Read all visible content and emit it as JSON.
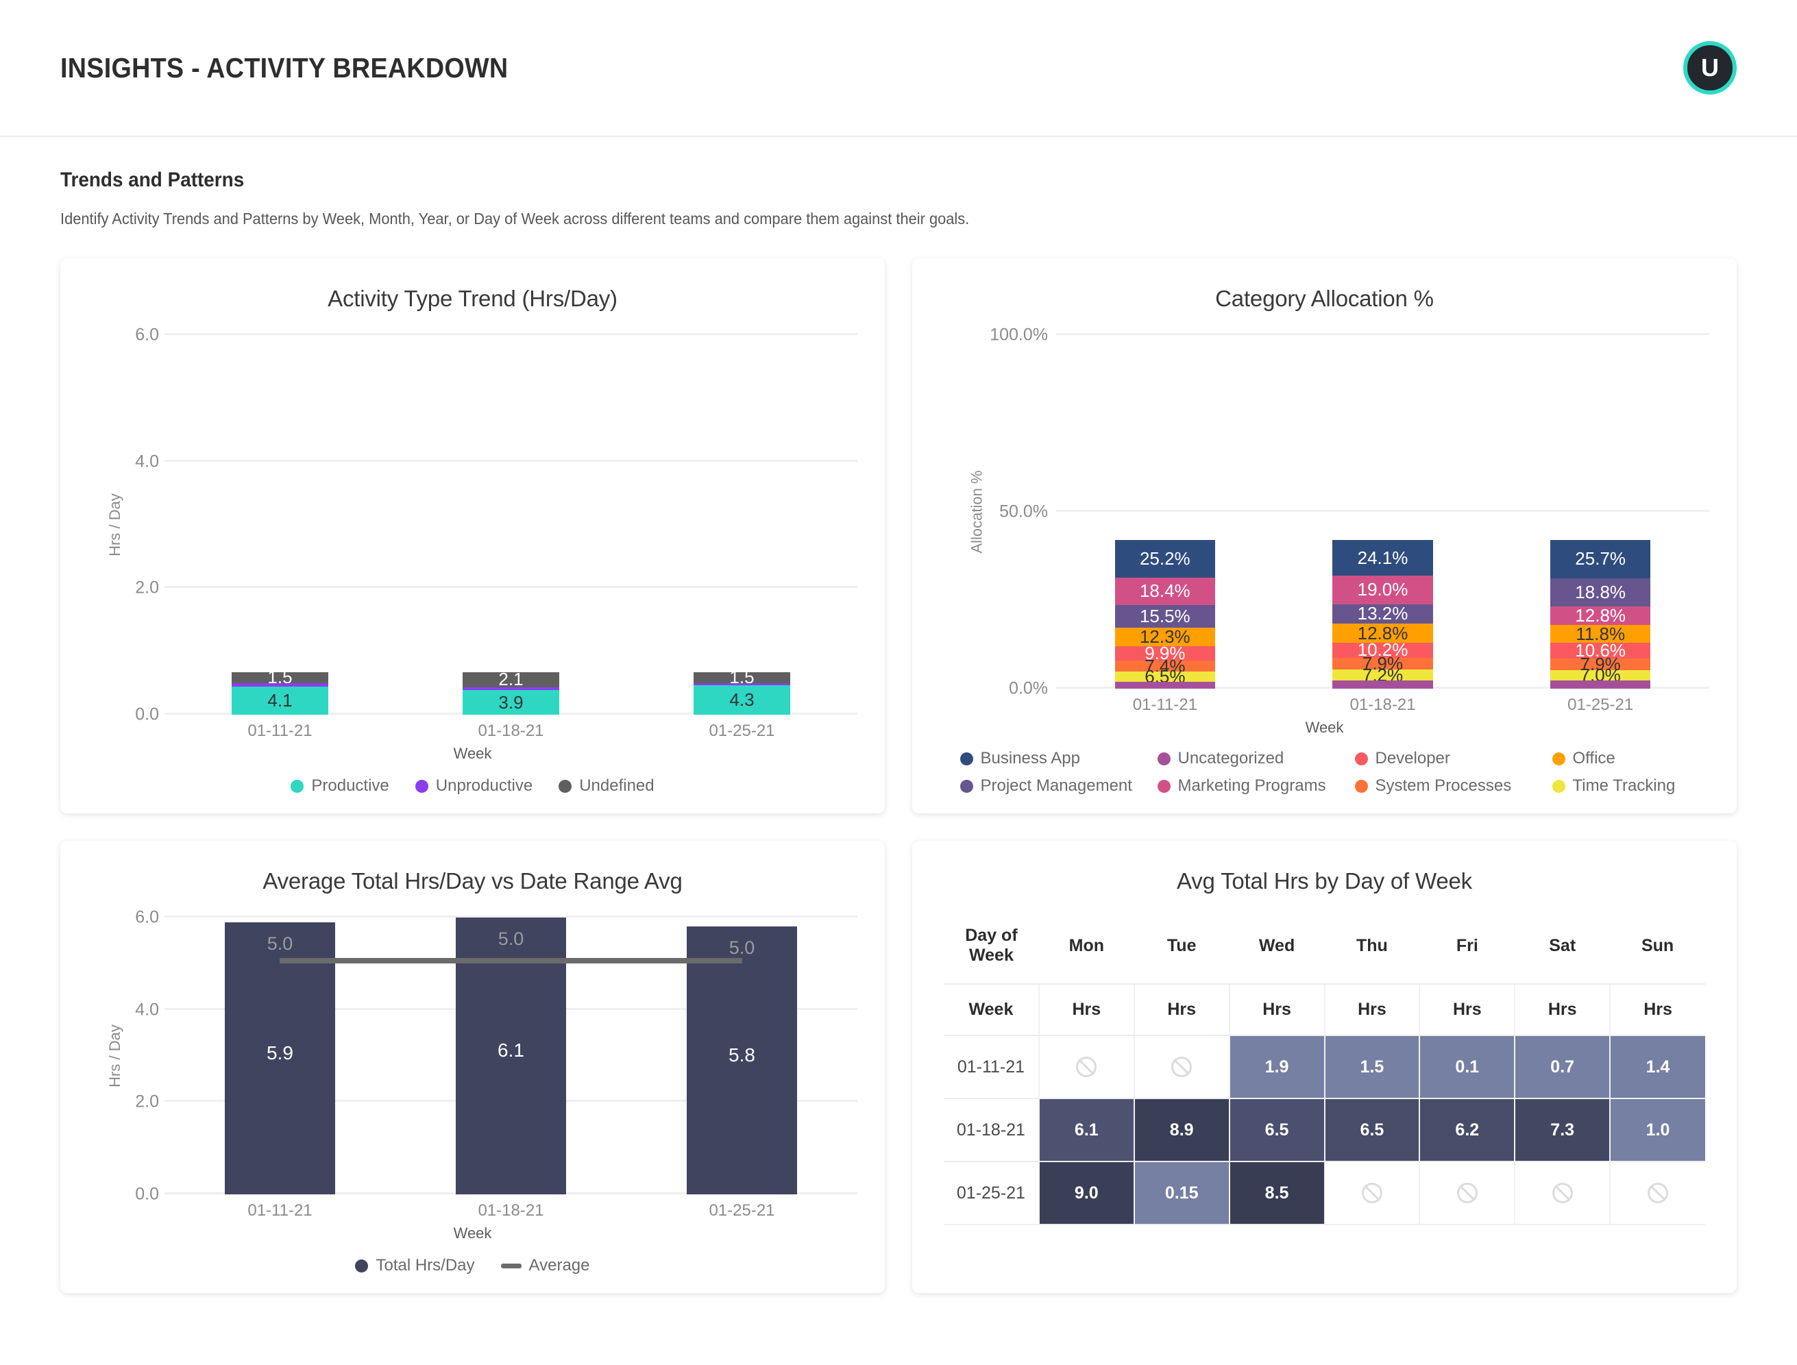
{
  "header": {
    "title": "INSIGHTS - ACTIVITY BREAKDOWN",
    "avatar_initial": "U",
    "avatar_ring_color": "#2fd9c4",
    "avatar_bg_color": "#23272e"
  },
  "section": {
    "title": "Trends and Patterns",
    "description": "Identify Activity Trends and Patterns by Week, Month, Year, or Day of Week across different teams and compare them against their goals."
  },
  "chart_data": [
    {
      "type": "bar",
      "id": "activity-type-trend",
      "title": "Activity Type Trend (Hrs/Day)",
      "xlabel": "Week",
      "ylabel": "Hrs / Day",
      "categories": [
        "01-11-21",
        "01-18-21",
        "01-25-21"
      ],
      "ylim": [
        0,
        6
      ],
      "yticks": [
        "0.0",
        "2.0",
        "4.0",
        "6.0"
      ],
      "stacked": true,
      "grid": true,
      "legend_position": "bottom",
      "series": [
        {
          "name": "Productive",
          "color": "#2ed7c2",
          "values": [
            4.1,
            3.9,
            4.3
          ],
          "labels": [
            "4.1",
            "3.9",
            "4.3"
          ]
        },
        {
          "name": "Unproductive",
          "color": "#8b3df0",
          "values": [
            0.5,
            0.5,
            0.3
          ],
          "labels": [
            "",
            "",
            ""
          ]
        },
        {
          "name": "Undefined",
          "color": "#5f5f5f",
          "values": [
            1.5,
            2.1,
            1.5
          ],
          "labels": [
            "1.5",
            "2.1",
            "1.5"
          ]
        }
      ]
    },
    {
      "type": "bar",
      "id": "category-allocation",
      "title": "Category Allocation %",
      "xlabel": "Week",
      "ylabel": "Allocation %",
      "categories": [
        "01-11-21",
        "01-18-21",
        "01-25-21"
      ],
      "ylim": [
        0,
        100
      ],
      "yticks": [
        "0.0%",
        "50.0%",
        "100.0%"
      ],
      "stacked": true,
      "grid": true,
      "legend_position": "bottom",
      "legend_entries": [
        {
          "name": "Business App",
          "color": "#2e4c7e"
        },
        {
          "name": "Uncategorized",
          "color": "#a6509b"
        },
        {
          "name": "Developer",
          "color": "#fa5a5f"
        },
        {
          "name": "Office",
          "color": "#ffa000"
        },
        {
          "name": "Project Management",
          "color": "#66558f"
        },
        {
          "name": "Marketing Programs",
          "color": "#d15186"
        },
        {
          "name": "System Processes",
          "color": "#fd7238"
        },
        {
          "name": "Time Tracking",
          "color": "#f0e63c"
        }
      ],
      "stacks": [
        {
          "category": "01-11-21",
          "segments": [
            {
              "name": "Business App",
              "color": "#2e4c7e",
              "value": 25.2,
              "label": "25.2%",
              "text_color": "#ffffff"
            },
            {
              "name": "Marketing Programs",
              "color": "#d15186",
              "value": 18.4,
              "label": "18.4%",
              "text_color": "#ffffff"
            },
            {
              "name": "Project Management",
              "color": "#66558f",
              "value": 15.5,
              "label": "15.5%",
              "text_color": "#ffffff"
            },
            {
              "name": "Office",
              "color": "#ffa000",
              "value": 12.3,
              "label": "12.3%",
              "text_color": "#333333"
            },
            {
              "name": "Developer",
              "color": "#fa5a5f",
              "value": 9.9,
              "label": "9.9%",
              "text_color": "#ffffff"
            },
            {
              "name": "System Processes",
              "color": "#fd7238",
              "value": 7.4,
              "label": "7.4%",
              "text_color": "#333333"
            },
            {
              "name": "Time Tracking",
              "color": "#f0e63c",
              "value": 6.5,
              "label": "6.5%",
              "text_color": "#333333"
            },
            {
              "name": "Uncategorized",
              "color": "#a6509b",
              "value": 4.8,
              "label": "",
              "text_color": "#ffffff"
            }
          ]
        },
        {
          "category": "01-18-21",
          "segments": [
            {
              "name": "Business App",
              "color": "#2e4c7e",
              "value": 24.1,
              "label": "24.1%",
              "text_color": "#ffffff"
            },
            {
              "name": "Marketing Programs",
              "color": "#d15186",
              "value": 19.0,
              "label": "19.0%",
              "text_color": "#ffffff"
            },
            {
              "name": "Project Management",
              "color": "#66558f",
              "value": 13.2,
              "label": "13.2%",
              "text_color": "#ffffff"
            },
            {
              "name": "Office",
              "color": "#ffa000",
              "value": 12.8,
              "label": "12.8%",
              "text_color": "#333333"
            },
            {
              "name": "Developer",
              "color": "#fa5a5f",
              "value": 10.2,
              "label": "10.2%",
              "text_color": "#ffffff"
            },
            {
              "name": "System Processes",
              "color": "#fd7238",
              "value": 7.9,
              "label": "7.9%",
              "text_color": "#333333"
            },
            {
              "name": "Time Tracking",
              "color": "#f0e63c",
              "value": 7.2,
              "label": "7.2%",
              "text_color": "#333333"
            },
            {
              "name": "Uncategorized",
              "color": "#a6509b",
              "value": 5.6,
              "label": "",
              "text_color": "#ffffff"
            }
          ]
        },
        {
          "category": "01-25-21",
          "segments": [
            {
              "name": "Business App",
              "color": "#2e4c7e",
              "value": 25.7,
              "label": "25.7%",
              "text_color": "#ffffff"
            },
            {
              "name": "Project Management",
              "color": "#66558f",
              "value": 18.8,
              "label": "18.8%",
              "text_color": "#ffffff"
            },
            {
              "name": "Marketing Programs",
              "color": "#d15186",
              "value": 12.8,
              "label": "12.8%",
              "text_color": "#ffffff"
            },
            {
              "name": "Office",
              "color": "#ffa000",
              "value": 11.8,
              "label": "11.8%",
              "text_color": "#333333"
            },
            {
              "name": "Developer",
              "color": "#fa5a5f",
              "value": 10.6,
              "label": "10.6%",
              "text_color": "#ffffff"
            },
            {
              "name": "System Processes",
              "color": "#fd7238",
              "value": 7.9,
              "label": "7.9%",
              "text_color": "#333333"
            },
            {
              "name": "Time Tracking",
              "color": "#f0e63c",
              "value": 7.0,
              "label": "7.0%",
              "text_color": "#333333"
            },
            {
              "name": "Uncategorized",
              "color": "#a6509b",
              "value": 5.4,
              "label": "",
              "text_color": "#ffffff"
            }
          ]
        }
      ]
    },
    {
      "type": "bar",
      "id": "avg-total-hrs-vs-range",
      "title": "Average Total Hrs/Day vs Date Range Avg",
      "xlabel": "Week",
      "ylabel": "Hrs / Day",
      "categories": [
        "01-11-21",
        "01-18-21",
        "01-25-21"
      ],
      "ylim": [
        0,
        6
      ],
      "yticks": [
        "0.0",
        "2.0",
        "4.0",
        "6.0"
      ],
      "grid": true,
      "legend_position": "bottom",
      "bar_color": "#3f455f",
      "average_color": "#6b6b6b",
      "values": [
        5.9,
        6.1,
        5.8
      ],
      "value_labels": [
        "5.9",
        "6.1",
        "5.8"
      ],
      "average": 5.0,
      "average_labels": [
        "5.0",
        "5.0",
        "5.0"
      ],
      "legend_entries": [
        {
          "name": "Total Hrs/Day",
          "color": "#3f455f",
          "marker": "dot"
        },
        {
          "name": "Average",
          "color": "#6b6b6b",
          "marker": "line"
        }
      ]
    },
    {
      "type": "heatmap",
      "id": "avg-total-hrs-by-day-of-week",
      "title": "Avg Total Hrs by Day of Week",
      "corner_header": "Day of Week",
      "row_header": "Week",
      "columns": [
        "Mon",
        "Tue",
        "Wed",
        "Thu",
        "Fri",
        "Sat",
        "Sun"
      ],
      "sub_headers": [
        "Hrs",
        "Hrs",
        "Hrs",
        "Hrs",
        "Hrs",
        "Hrs",
        "Hrs"
      ],
      "no_value_icon": "no-data-icon",
      "rows": [
        {
          "week": "01-11-21",
          "cells": [
            {
              "value": null,
              "label": "",
              "color": ""
            },
            {
              "value": null,
              "label": "",
              "color": ""
            },
            {
              "value": 1.9,
              "label": "1.9",
              "color": "#7680a3"
            },
            {
              "value": 1.5,
              "label": "1.5",
              "color": "#7680a3"
            },
            {
              "value": 0.1,
              "label": "0.1",
              "color": "#7680a3"
            },
            {
              "value": 0.7,
              "label": "0.7",
              "color": "#7680a3"
            },
            {
              "value": 1.4,
              "label": "1.4",
              "color": "#7680a3"
            }
          ]
        },
        {
          "week": "01-18-21",
          "cells": [
            {
              "value": 6.1,
              "label": "6.1",
              "color": "#4d5270"
            },
            {
              "value": 8.9,
              "label": "8.9",
              "color": "#3a3f58"
            },
            {
              "value": 6.5,
              "label": "6.5",
              "color": "#4b5070"
            },
            {
              "value": 6.5,
              "label": "6.5",
              "color": "#474c68"
            },
            {
              "value": 6.2,
              "label": "6.2",
              "color": "#474c68"
            },
            {
              "value": 7.3,
              "label": "7.3",
              "color": "#434862"
            },
            {
              "value": 1.0,
              "label": "1.0",
              "color": "#7680a3"
            }
          ]
        },
        {
          "week": "01-25-21",
          "cells": [
            {
              "value": 9.0,
              "label": "9.0",
              "color": "#3a3f58"
            },
            {
              "value": 0.15,
              "label": "0.15",
              "color": "#7680a3"
            },
            {
              "value": 8.5,
              "label": "8.5",
              "color": "#383d54"
            },
            {
              "value": null,
              "label": "",
              "color": ""
            },
            {
              "value": null,
              "label": "",
              "color": ""
            },
            {
              "value": null,
              "label": "",
              "color": ""
            },
            {
              "value": null,
              "label": "",
              "color": ""
            }
          ]
        }
      ]
    }
  ]
}
